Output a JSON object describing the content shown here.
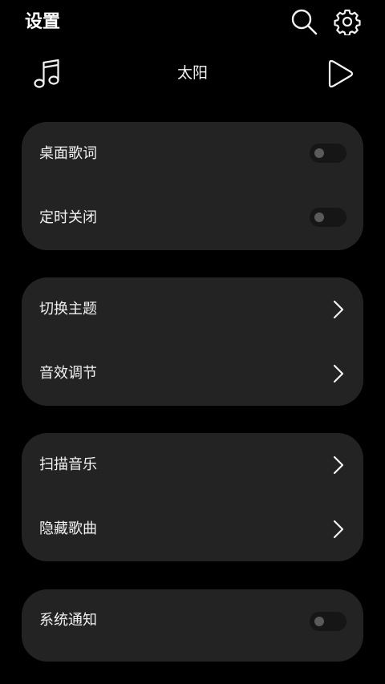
{
  "header": {
    "title": "设置",
    "search_icon": "search-icon",
    "settings_icon": "gear-icon"
  },
  "player": {
    "song_title": "太阳",
    "music_icon": "music-note-icon",
    "play_icon": "play-icon"
  },
  "groups": [
    {
      "items": [
        {
          "label": "桌面歌词",
          "control": "toggle",
          "on": false
        },
        {
          "label": "定时关闭",
          "control": "toggle",
          "on": false
        }
      ]
    },
    {
      "items": [
        {
          "label": "切换主题",
          "control": "chevron"
        },
        {
          "label": "音效调节",
          "control": "chevron"
        }
      ]
    },
    {
      "items": [
        {
          "label": "扫描音乐",
          "control": "chevron"
        },
        {
          "label": "隐藏歌曲",
          "control": "chevron"
        }
      ]
    },
    {
      "items": [
        {
          "label": "系统通知",
          "control": "toggle",
          "on": false
        }
      ]
    }
  ],
  "colors": {
    "background": "#000000",
    "card": "#232323",
    "text": "#f2f2f2",
    "toggle_track": "#161616",
    "toggle_knob": "#5a5a5a"
  }
}
